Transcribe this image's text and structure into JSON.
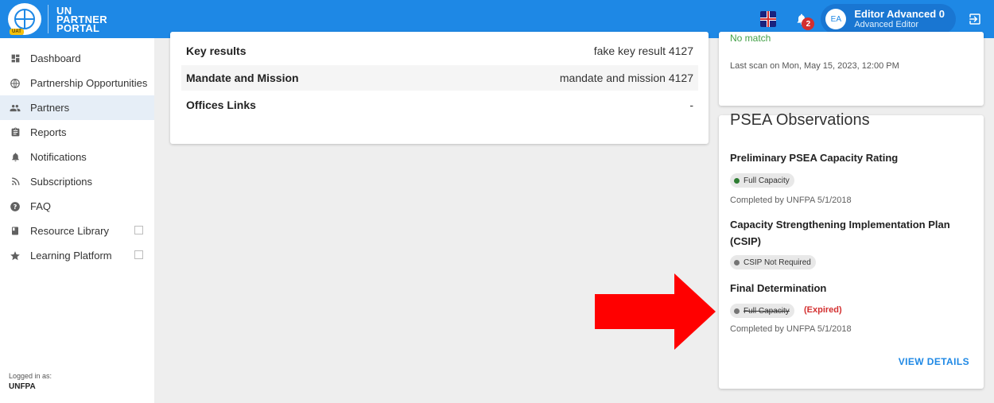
{
  "header": {
    "logo_text_lines": [
      "UN",
      "PARTNER",
      "PORTAL"
    ],
    "env_badge": "UAT",
    "notification_count": "2",
    "user": {
      "initials": "EA",
      "name": "Editor Advanced 0",
      "role": "Advanced Editor"
    }
  },
  "sidebar": {
    "items": [
      {
        "label": "Dashboard",
        "icon": "dashboard-icon"
      },
      {
        "label": "Partnership Opportunities",
        "icon": "globe-icon"
      },
      {
        "label": "Partners",
        "icon": "people-icon",
        "active": true
      },
      {
        "label": "Reports",
        "icon": "clipboard-icon"
      },
      {
        "label": "Notifications",
        "icon": "bell-icon"
      },
      {
        "label": "Subscriptions",
        "icon": "rss-icon"
      },
      {
        "label": "FAQ",
        "icon": "help-icon"
      },
      {
        "label": "Resource Library",
        "icon": "book-icon",
        "external": true
      },
      {
        "label": "Learning Platform",
        "icon": "star-icon",
        "external": true
      }
    ],
    "logged_in_label": "Logged in as:",
    "logged_in_org": "UNFPA"
  },
  "main": {
    "rows": [
      {
        "key": "Key results",
        "value": "fake key result 4127"
      },
      {
        "key": "Mandate and Mission",
        "value": "mandate and mission 4127"
      },
      {
        "key": "Offices Links",
        "value": "-"
      }
    ]
  },
  "scan": {
    "status": "No match",
    "last_scan": "Last scan on Mon, May 15, 2023, 12:00 PM"
  },
  "psea": {
    "title": "PSEA Observations",
    "preliminary": {
      "title": "Preliminary PSEA Capacity Rating",
      "chip": "Full Capacity",
      "chip_color": "#2e7d32",
      "completed": "Completed by UNFPA 5/1/2018"
    },
    "csip": {
      "title_line1": "Capacity Strengthening Implementation Plan",
      "title_line2": "(CSIP)",
      "chip": "CSIP Not Required",
      "chip_color": "#757575"
    },
    "final": {
      "title": "Final Determination",
      "chip": "Full Capacity",
      "chip_color": "#757575",
      "expired": "(Expired)",
      "completed": "Completed by UNFPA 5/1/2018"
    },
    "view_details": "VIEW DETAILS"
  },
  "colors": {
    "header": "#1e88e5",
    "accent": "#1e88e5",
    "arrow": "#ff0000",
    "expired": "#d32f2f",
    "no_match": "#43a047"
  }
}
